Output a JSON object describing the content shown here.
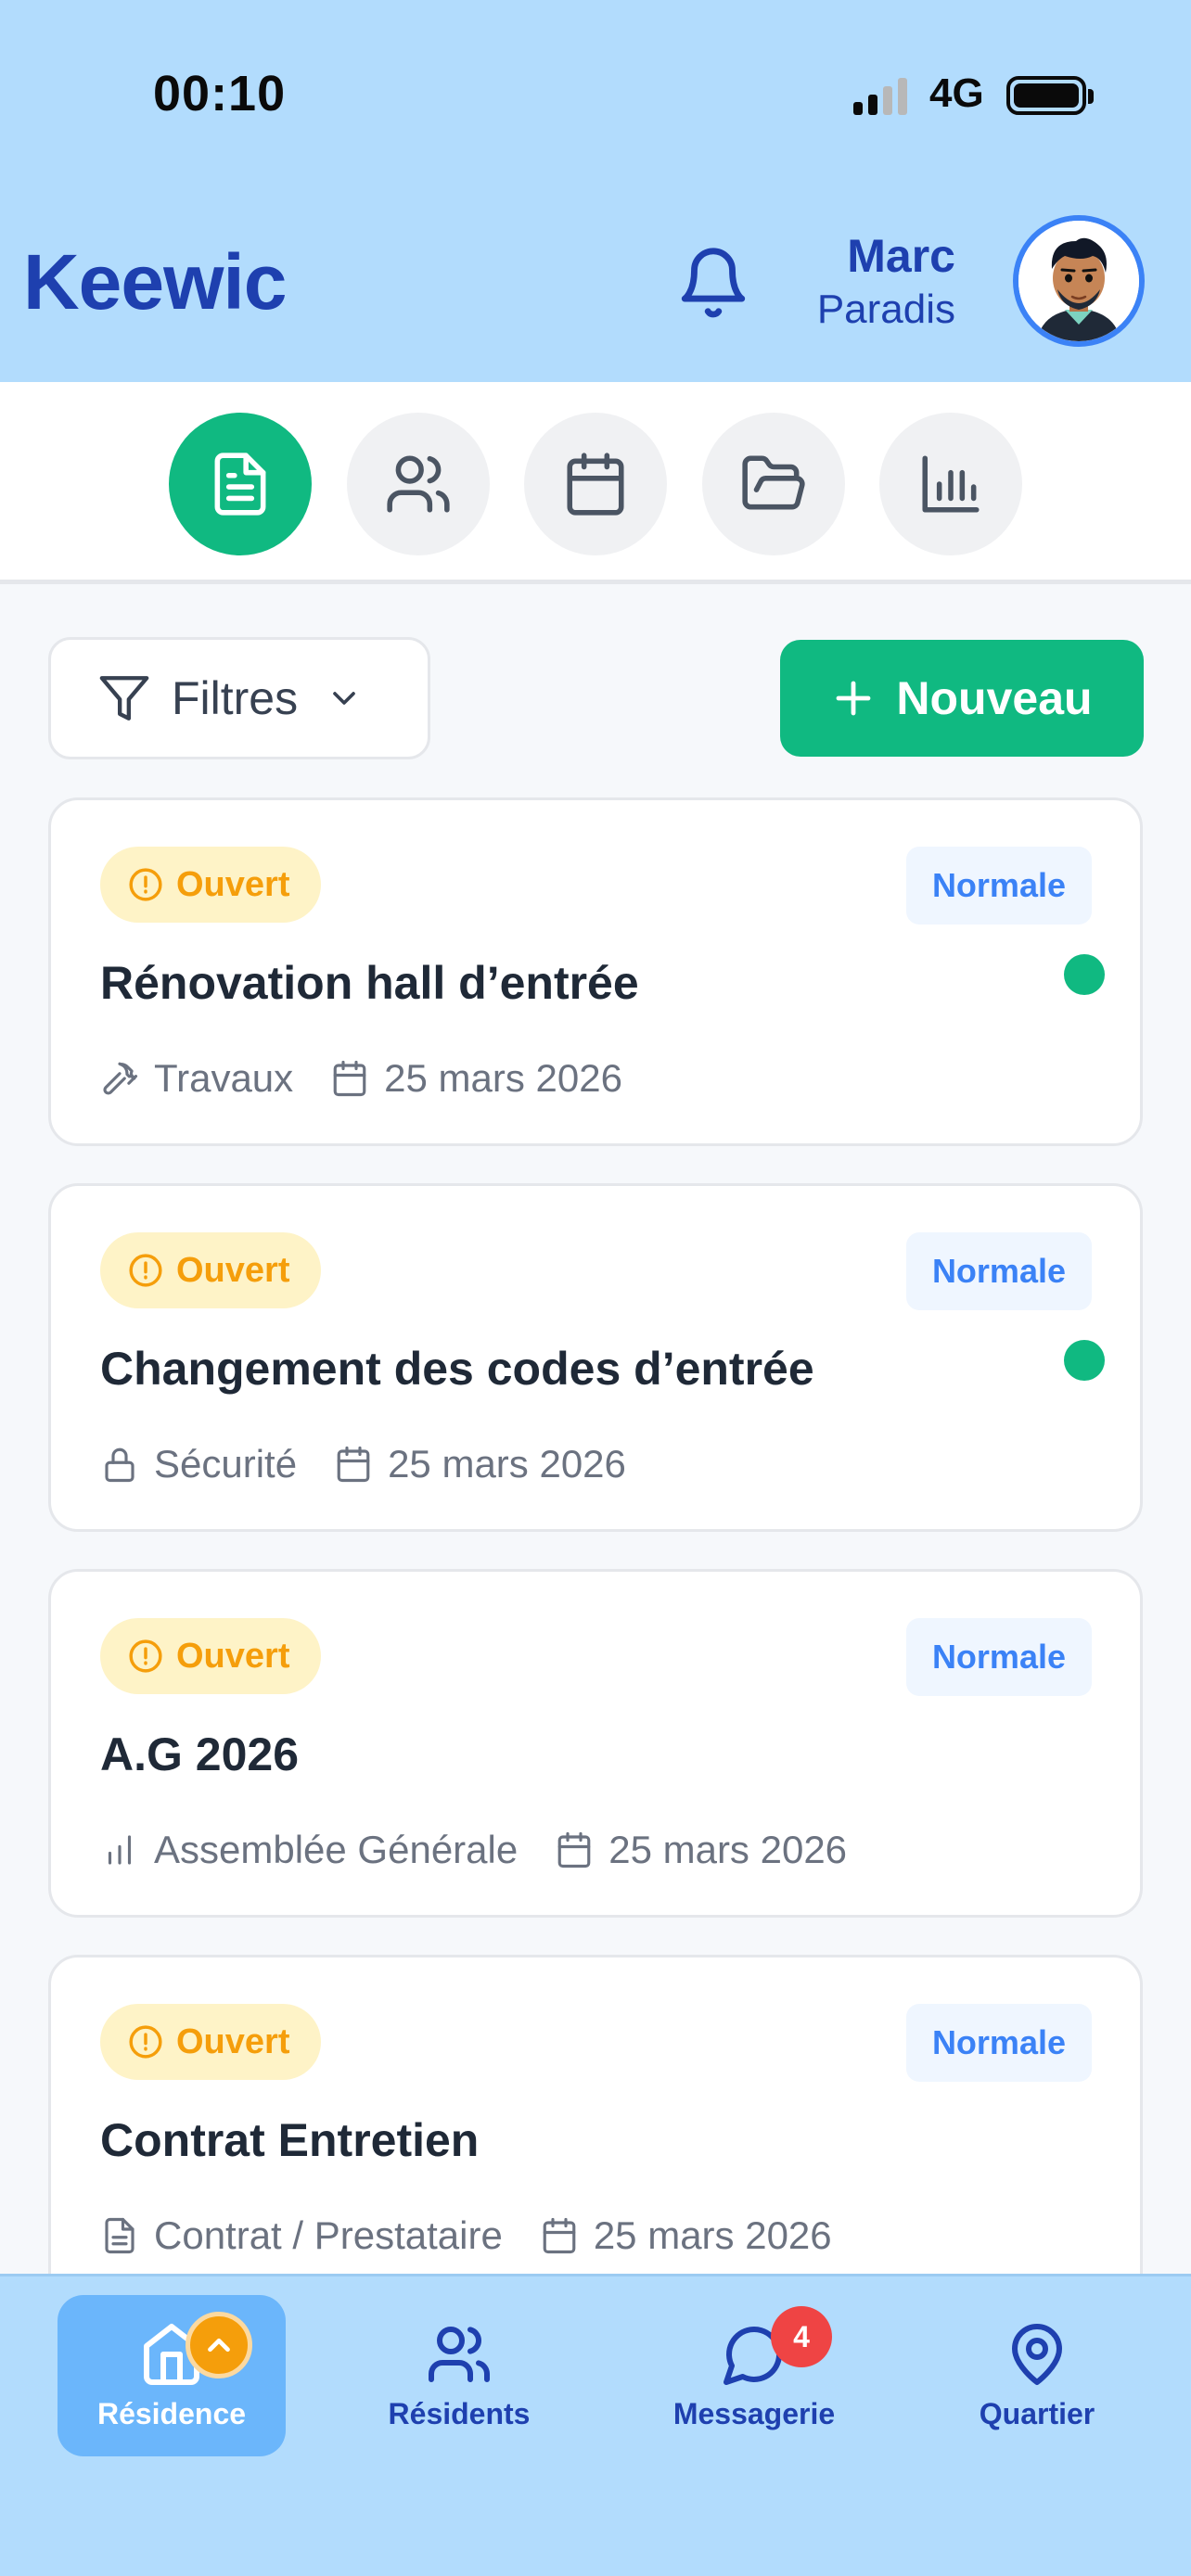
{
  "status_bar": {
    "time": "00:10",
    "network": "4G"
  },
  "header": {
    "brand": "Keewic",
    "user_first": "Marc",
    "user_last": "Paradis"
  },
  "tabs": [
    {
      "icon": "document-icon",
      "active": true
    },
    {
      "icon": "users-icon",
      "active": false
    },
    {
      "icon": "calendar-icon",
      "active": false
    },
    {
      "icon": "folder-icon",
      "active": false
    },
    {
      "icon": "bar-chart-icon",
      "active": false
    }
  ],
  "toolbar": {
    "filters_label": "Filtres",
    "new_label": "Nouveau"
  },
  "tickets": [
    {
      "status": "Ouvert",
      "priority": "Normale",
      "title": "Rénovation hall d’entrée",
      "category": "Travaux",
      "category_icon": "hammer-icon",
      "date": "25 mars 2026",
      "dot": true
    },
    {
      "status": "Ouvert",
      "priority": "Normale",
      "title": "Changement des codes d’entrée",
      "category": "Sécurité",
      "category_icon": "lock-icon",
      "date": "25 mars 2026",
      "dot": true
    },
    {
      "status": "Ouvert",
      "priority": "Normale",
      "title": "A.G 2026",
      "category": "Assemblée Générale",
      "category_icon": "bar-chart-icon",
      "date": "25 mars 2026",
      "dot": false
    },
    {
      "status": "Ouvert",
      "priority": "Normale",
      "title": "Contrat Entretien",
      "category": "Contrat / Prestataire",
      "category_icon": "document-icon",
      "date": "25 mars 2026",
      "dot": false
    }
  ],
  "bottom_nav": {
    "items": [
      {
        "label": "Résidence",
        "icon": "home-icon",
        "active": true
      },
      {
        "label": "Résidents",
        "icon": "users-icon",
        "active": false
      },
      {
        "label": "Messagerie",
        "icon": "chat-icon",
        "active": false,
        "badge": "4"
      },
      {
        "label": "Quartier",
        "icon": "map-pin-icon",
        "active": false
      }
    ]
  },
  "colors": {
    "accent": "#10B981",
    "brand": "#1E40AF",
    "header_bg": "#B2DCFD",
    "open_badge": "#F59E0B",
    "priority": "#3B82F6"
  }
}
